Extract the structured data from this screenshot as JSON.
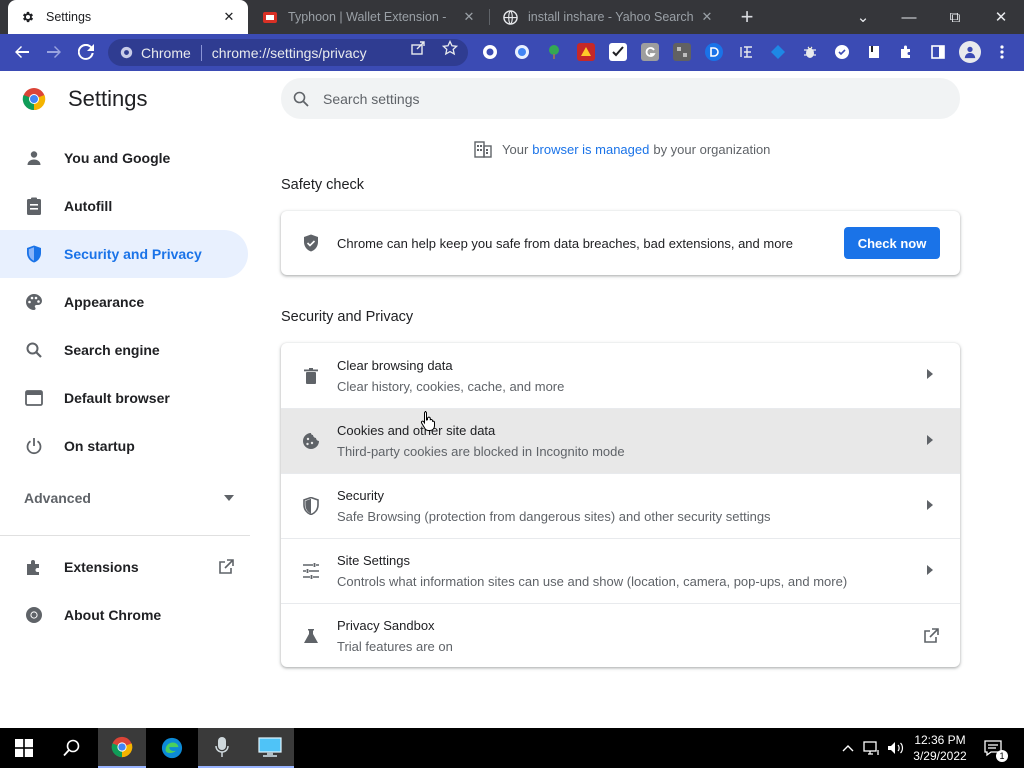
{
  "browser": {
    "tabs": [
      {
        "title": "Settings",
        "active": true
      },
      {
        "title": "Typhoon | Wallet Extension -",
        "active": false
      },
      {
        "title": "install inshare - Yahoo Search",
        "active": false
      }
    ],
    "new_tab_symbol": "+",
    "window_controls": {
      "dropdown": "⌄",
      "minimize": "—",
      "maximize": "⧉",
      "close": "✕"
    },
    "omnibox": {
      "site_chip": "Chrome",
      "url": "chrome://settings/privacy"
    }
  },
  "settings": {
    "title": "Settings",
    "search_placeholder": "Search settings",
    "nav": [
      {
        "label": "You and Google",
        "icon": "person-icon"
      },
      {
        "label": "Autofill",
        "icon": "clipboard-icon"
      },
      {
        "label": "Security and Privacy",
        "icon": "shield-icon",
        "active": true
      },
      {
        "label": "Appearance",
        "icon": "palette-icon"
      },
      {
        "label": "Search engine",
        "icon": "search-icon"
      },
      {
        "label": "Default browser",
        "icon": "browser-icon"
      },
      {
        "label": "On startup",
        "icon": "power-icon"
      }
    ],
    "advanced_label": "Advanced",
    "extensions_label": "Extensions",
    "about_label": "About Chrome",
    "managed": {
      "prefix": "Your",
      "link": "browser is managed",
      "suffix": "by your organization"
    },
    "safety_check": {
      "title": "Safety check",
      "text": "Chrome can help keep you safe from data breaches, bad extensions, and more",
      "button": "Check now"
    },
    "privacy_section": {
      "title": "Security and Privacy",
      "rows": [
        {
          "primary": "Clear browsing data",
          "secondary": "Clear history, cookies, cache, and more",
          "icon": "trash-icon"
        },
        {
          "primary": "Cookies and other site data",
          "secondary": "Third-party cookies are blocked in Incognito mode",
          "icon": "cookie-icon"
        },
        {
          "primary": "Security",
          "secondary": "Safe Browsing (protection from dangerous sites) and other security settings",
          "icon": "shield-icon"
        },
        {
          "primary": "Site Settings",
          "secondary": "Controls what information sites can use and show (location, camera, pop-ups, and more)",
          "icon": "tune-icon"
        },
        {
          "primary": "Privacy Sandbox",
          "secondary": "Trial features are on",
          "icon": "flask-icon"
        }
      ]
    }
  },
  "taskbar": {
    "time": "12:36 PM",
    "date": "3/29/2022",
    "notification_count": "1"
  },
  "colors": {
    "toolbar": "#3b4bb4",
    "accent": "#1a73e8",
    "tabstrip": "#35363a"
  }
}
